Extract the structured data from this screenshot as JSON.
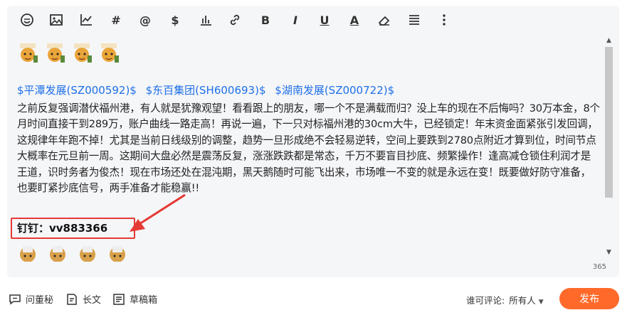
{
  "toolbar": {
    "icons": [
      "emoji-icon",
      "image-icon",
      "chart-icon",
      "hashtag-icon",
      "mention-icon",
      "dollar-icon",
      "bar-chart-icon",
      "link-icon",
      "bold-icon",
      "italic-icon",
      "underline-icon",
      "font-color-icon",
      "eraser-icon",
      "align-icon",
      "more-icon"
    ],
    "hash_glyph": "#",
    "at_glyph": "@",
    "dollar_glyph": "$",
    "bold_glyph": "B",
    "italic_glyph": "I",
    "underline_glyph": "U",
    "fontcolor_glyph": "A"
  },
  "content": {
    "stocks": [
      "$平潭发展(SZ000592)$",
      "$东百集团(SH600693)$",
      "$湖南发展(SZ000722)$"
    ],
    "paragraph": "之前反复强调潜伏福州港，有人就是犹豫观望！看看跟上的朋友，哪一个不是满载而归？没上车的现在不后悔吗？30万本金，8个月时间直接干到289万，账户曲线一路走高！再说一遍，下一只对标福州港的30cm大牛，已经锁定！年末资金面紧张引发回调，这规律年年跑不掉！尤其是当前日线级别的调整，趋势一旦形成绝不会轻易逆转，空间上要跌到2780点附近才算到位，时间节点大概率在元旦前一周。这期间大盘必然是震荡反复，涨涨跌跌都是常态，千万不要盲目抄底、频繁操作！逢高减仓锁住利润才是王道，识时务者为俊杰！现在市场还处在混沌期，黑天鹅随时可能飞出来，市场唯一不变的就是永远在变！既要做好防守准备，也要盯紧抄底信号，两手准备才能稳赢!!",
    "contact": "钉钉：vv883366"
  },
  "counter": "365",
  "bottom": {
    "ask": "问董秘",
    "long": "长文",
    "draft": "草稿箱",
    "perm_label": "谁可评论:",
    "perm_value": "所有人",
    "publish": "发布"
  },
  "colors": {
    "accent": "#ff6a2b",
    "link": "#1e6fe8",
    "highlight": "#e53935"
  }
}
